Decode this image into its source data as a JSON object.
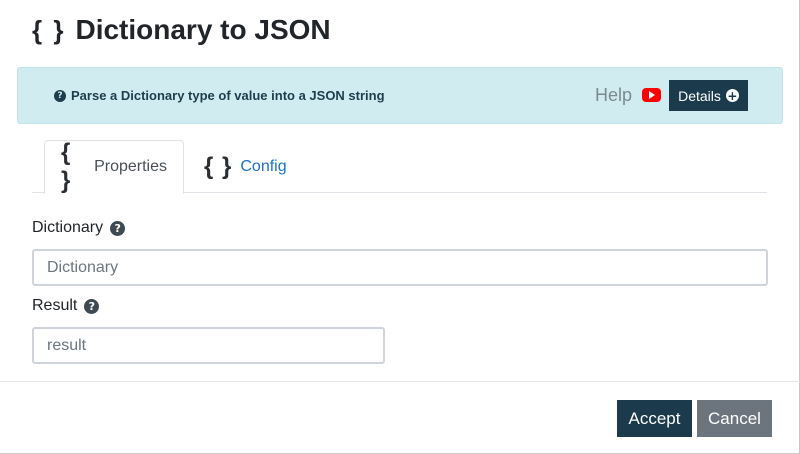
{
  "dialog": {
    "title_icon": "{ }",
    "title": "Dictionary to JSON"
  },
  "info": {
    "question_icon": "?",
    "text": "Parse a Dictionary type of value into a JSON string",
    "help_label": "Help",
    "details_label": "Details",
    "details_icon": "+"
  },
  "tabs": [
    {
      "icon": "{ }",
      "label": "Properties",
      "active": true
    },
    {
      "icon": "{ }",
      "label": "Config",
      "active": false
    }
  ],
  "fields": {
    "dictionary": {
      "label": "Dictionary",
      "help_icon": "?",
      "value": "",
      "placeholder": "Dictionary"
    },
    "result": {
      "label": "Result",
      "help_icon": "?",
      "value": "",
      "placeholder": "result"
    }
  },
  "footer": {
    "accept_label": "Accept",
    "cancel_label": "Cancel"
  },
  "colors": {
    "info_bg": "#d1ecf1",
    "primary": "#1b3a4b",
    "secondary": "#6c757d",
    "link": "#1a73c8",
    "youtube": "#ff0000"
  }
}
